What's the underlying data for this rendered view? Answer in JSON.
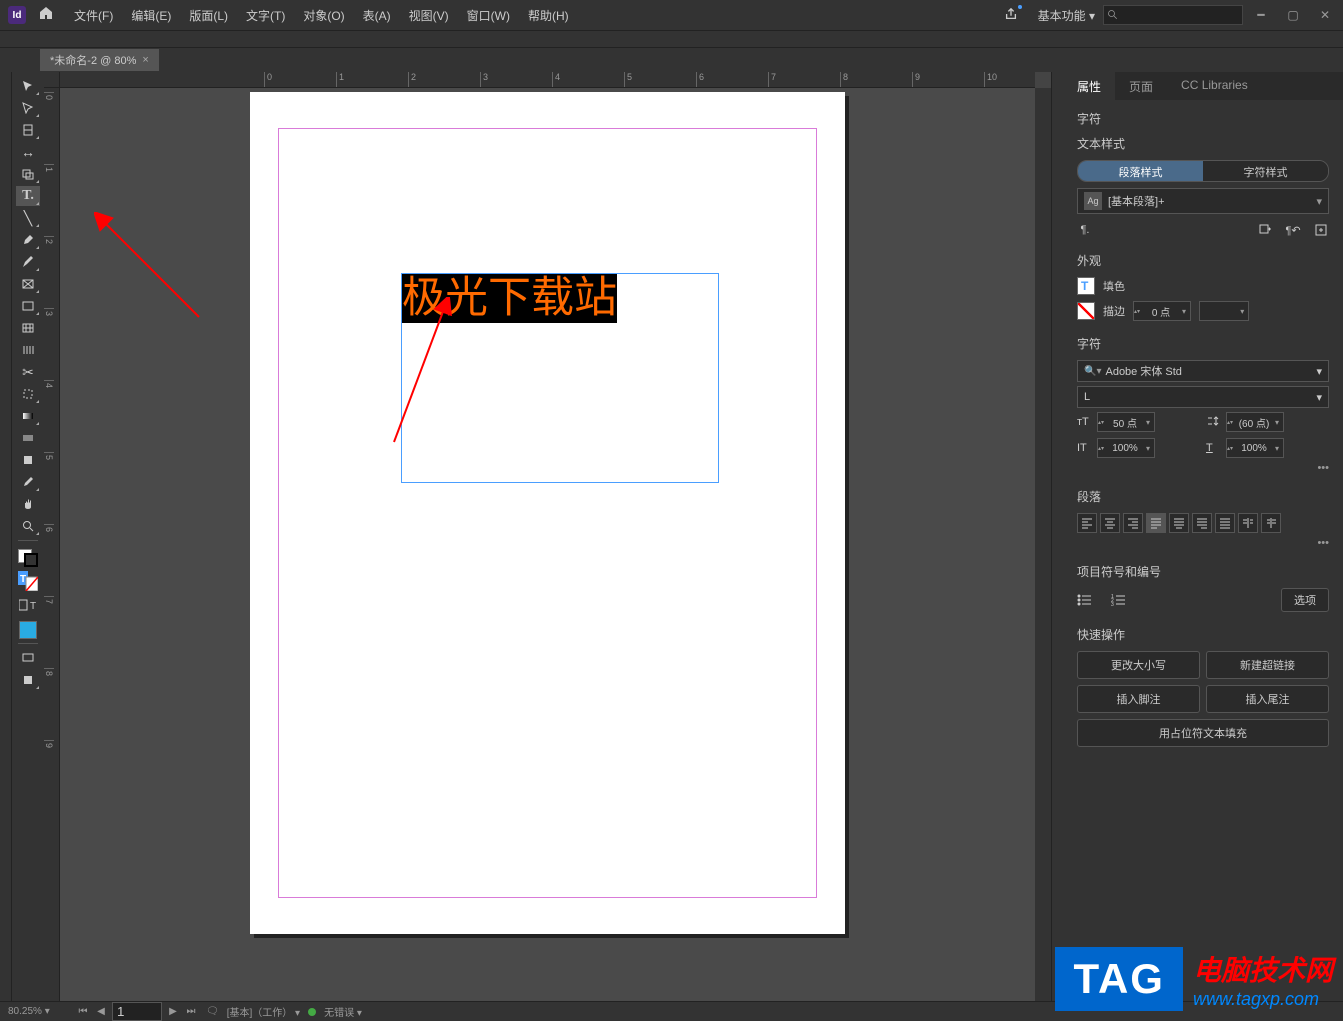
{
  "menubar": {
    "logo": "Id",
    "items": [
      "文件(F)",
      "编辑(E)",
      "版面(L)",
      "文字(T)",
      "对象(O)",
      "表(A)",
      "视图(V)",
      "窗口(W)",
      "帮助(H)"
    ],
    "workspace": "基本功能"
  },
  "tab": {
    "title": "*未命名-2 @ 80%"
  },
  "ruler_h": [
    "0",
    "1",
    "2",
    "3",
    "4",
    "5",
    "6",
    "7",
    "8",
    "9",
    "10"
  ],
  "ruler_v": [
    "0",
    "1",
    "2",
    "3",
    "4",
    "5",
    "6",
    "7",
    "8",
    "9"
  ],
  "canvas": {
    "text": "极光下载站"
  },
  "panels": {
    "tabs": [
      "属性",
      "页面",
      "CC Libraries"
    ],
    "char_header": "字符",
    "text_style": {
      "title": "文本样式",
      "para": "段落样式",
      "char": "字符样式",
      "current": "[基本段落]+",
      "ag": "Ag"
    },
    "appearance": {
      "title": "外观",
      "fill": "填色",
      "stroke": "描边",
      "stroke_val": "0 点"
    },
    "character": {
      "title": "字符",
      "font": "Adobe 宋体 Std",
      "weight": "L",
      "size": "50 点",
      "leading": "(60 点)",
      "vscale": "100%",
      "hscale": "100%"
    },
    "paragraph": {
      "title": "段落"
    },
    "bullets": {
      "title": "项目符号和编号",
      "options": "选项"
    },
    "quick": {
      "title": "快速操作",
      "btns": [
        "更改大小写",
        "新建超链接",
        "插入脚注",
        "插入尾注",
        "用占位符文本填充"
      ]
    }
  },
  "statusbar": {
    "zoom": "80.25%",
    "page": "1",
    "profile": "[基本]（工作）",
    "errors": "无错误"
  },
  "watermark": {
    "tag": "TAG",
    "cn": "电脑技术网",
    "url": "www.tagxp.com"
  }
}
